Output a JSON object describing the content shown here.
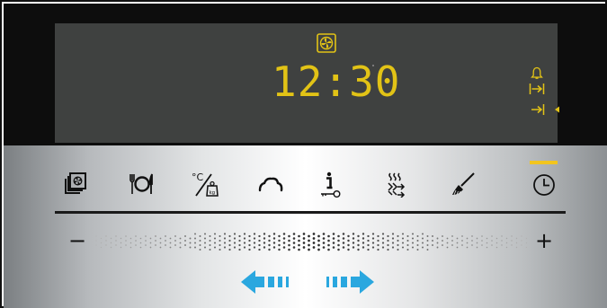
{
  "display": {
    "clock": "12:30"
  },
  "colors": {
    "display_yellow": "#e2c316",
    "selected_indicator": "#f2c51e",
    "arrow_blue": "#2aa7df",
    "lcd_background": "#3f4140",
    "bezel": "#0d0d0d"
  },
  "display_icons": [
    "fan-mode-icon",
    "minute-minder-bell-icon",
    "start-time-icon",
    "end-time-icon",
    "small-arrow-left-icon"
  ],
  "buttons": [
    {
      "name": "fan-functions-button",
      "icon": "fan-stack-icon"
    },
    {
      "name": "meal-programs-button",
      "icon": "plate-cutlery-icon"
    },
    {
      "name": "temperature-weight-button",
      "icon": "celsius-weight-icon"
    },
    {
      "name": "rapid-heat-button",
      "icon": "cloud-icon"
    },
    {
      "name": "info-lock-button",
      "icon": "info-key-icon"
    },
    {
      "name": "heat-up-steam-button",
      "icon": "heat-arrows-icon"
    },
    {
      "name": "cleaning-button",
      "icon": "brush-icon"
    },
    {
      "name": "clock-button",
      "icon": "clock-icon",
      "selected": true
    }
  ],
  "slider": {
    "minus_label": "−",
    "plus_label": "+"
  },
  "navigation": {
    "left_icon": "arrow-left-icon",
    "right_icon": "arrow-right-icon"
  }
}
